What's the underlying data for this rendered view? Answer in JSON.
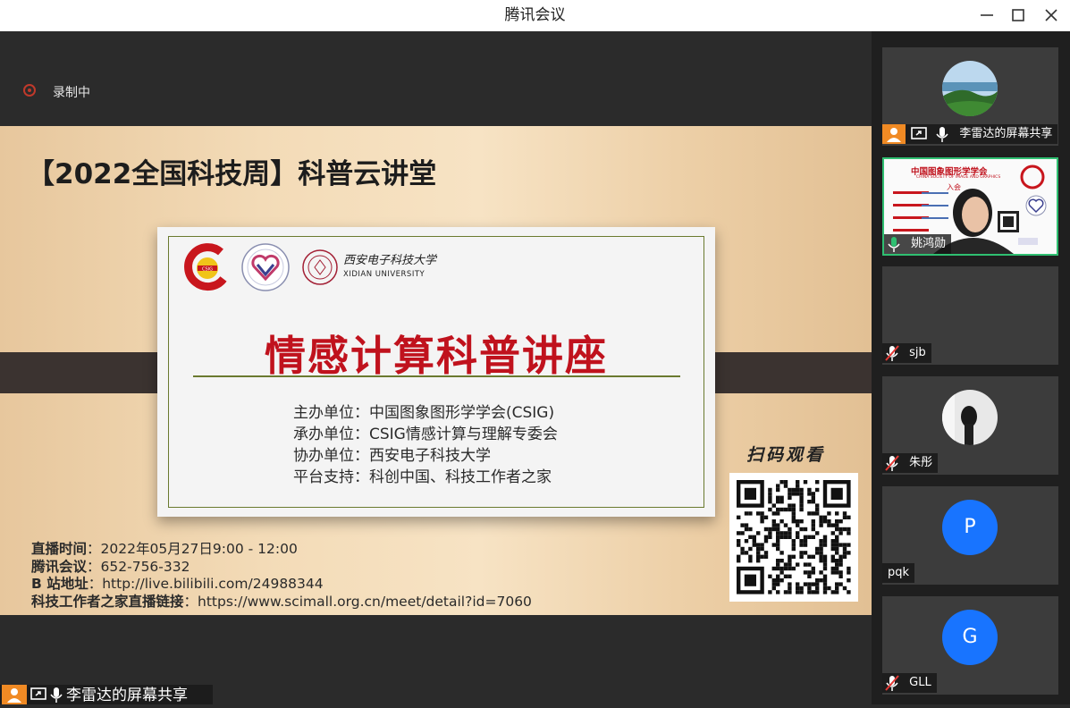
{
  "window": {
    "title": "腾讯会议"
  },
  "recording": {
    "label": "录制中"
  },
  "slide": {
    "title": "【2022全国科技周】科普云讲堂",
    "heading": "情感计算科普讲座",
    "logo_csig": "CSIG",
    "logo_university_cn": "西安电子科技大学",
    "logo_university_en": "XIDIAN UNIVERSITY",
    "info": [
      "主办单位：中国图象图形学学会(CSIG)",
      "承办单位：CSIG情感计算与理解专委会",
      "协办单位：西安电子科技大学",
      "平台支持：科创中国、科技工作者之家"
    ],
    "footer": [
      {
        "label": "直播时间",
        "value": "2022年05月27日9:00 - 12:00"
      },
      {
        "label": "腾讯会议",
        "value": "652-756-332"
      },
      {
        "label": "B 站地址",
        "value": "http://live.bilibili.com/24988344"
      },
      {
        "label": "科技工作者之家直播链接",
        "value": "https://www.scimall.org.cn/meet/detail?id=7060"
      }
    ],
    "scan_label": "扫码观看"
  },
  "share_bar": {
    "label": "李雷达的屏幕共享"
  },
  "participants": [
    {
      "name": "李雷达的屏幕共享",
      "mic": "on",
      "sharing": true,
      "avatar": "photo"
    },
    {
      "name": "姚鸿勋",
      "mic": "on",
      "sharing": false,
      "avatar": "video",
      "active": true,
      "video_text": {
        "title": "中国图象图形学学会",
        "subtitle": "CHINA SOCIETY OF IMAGE AND GRAPHICS",
        "join": "入会"
      }
    },
    {
      "name": "sjb",
      "mic": "muted",
      "sharing": false,
      "avatar": "none"
    },
    {
      "name": "朱彤",
      "mic": "muted",
      "sharing": false,
      "avatar": "photo"
    },
    {
      "name": "pqk",
      "mic": "none",
      "sharing": false,
      "avatar": "letter",
      "letter": "P"
    },
    {
      "name": "GLL",
      "mic": "muted",
      "sharing": false,
      "avatar": "letter",
      "letter": "G"
    }
  ],
  "colors": {
    "accent_active": "#2fbf71",
    "avatar_blue": "#1874ff",
    "heading_red": "#c0121d",
    "record_red": "#c0392b"
  }
}
